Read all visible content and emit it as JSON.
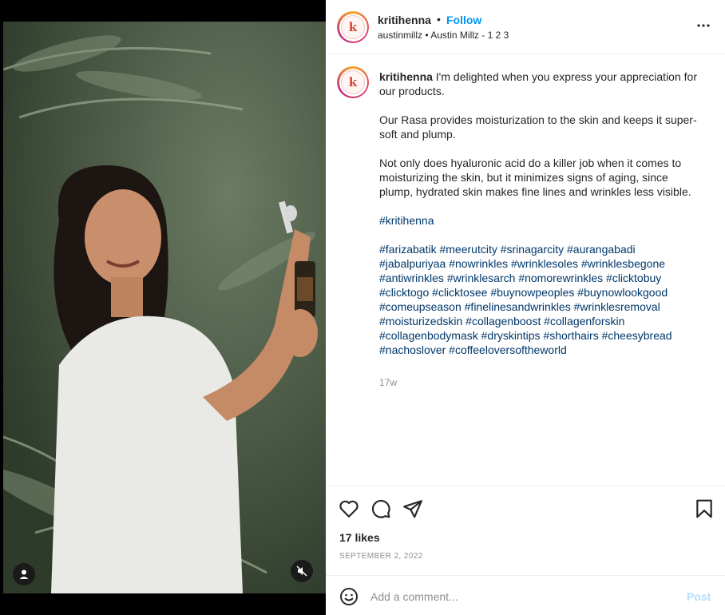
{
  "header": {
    "username": "kritihenna",
    "separator": "•",
    "follow_label": "Follow",
    "subtitle": "austinmillz • Austin Millz - 1 2 3",
    "avatar_letter": "k"
  },
  "caption": {
    "username": "kritihenna",
    "intro": "I'm delighted when you express your appreciation for our products.",
    "para2": "Our Rasa provides moisturization to the skin and keeps it super-soft and plump.",
    "para3": "Not only does hyaluronic acid do a killer job when it comes to moisturizing the skin, but it minimizes signs of aging, since plump, hydrated skin makes fine lines and wrinkles less visible.",
    "brand_tag": "#kritihenna",
    "hashtags": [
      "#farizabatik",
      "#meerutcity",
      "#srinagarcity",
      "#aurangabadi",
      "#jabalpuriyaa",
      "#nowrinkles",
      "#wrinklesoles",
      "#wrinklesbegone",
      "#antiwrinkles",
      "#wrinklesarch",
      "#nomorewrinkles",
      "#clicktobuy",
      "#clicktogo",
      "#clicktosee",
      "#buynowpeoples",
      "#buynowlookgood",
      "#comeupseason",
      "#finelinesandwrinkles",
      "#wrinklesremoval",
      "#moisturizedskin",
      "#collagenboost",
      "#collagenforskin",
      "#collagenbodymask",
      "#dryskintips",
      "#shorthairs",
      "#cheesybread",
      "#nachoslover",
      "#coffeeloversoftheworld"
    ],
    "time_ago": "17w"
  },
  "engagement": {
    "likes": "17 likes",
    "date": "SEPTEMBER 2, 2022"
  },
  "comment": {
    "placeholder": "Add a comment...",
    "post_label": "Post"
  },
  "icons": {
    "more": "more-options-icon",
    "like": "heart-icon",
    "comment": "comment-icon",
    "share": "share-icon",
    "save": "bookmark-icon",
    "emoji": "emoji-icon",
    "tag": "user-tag-icon",
    "mute": "muted-audio-icon"
  },
  "colors": {
    "accent": "#0095f6",
    "hashtag": "#00376b",
    "post_disabled": "#b2dffc",
    "muted_text": "#8e8e8e"
  }
}
